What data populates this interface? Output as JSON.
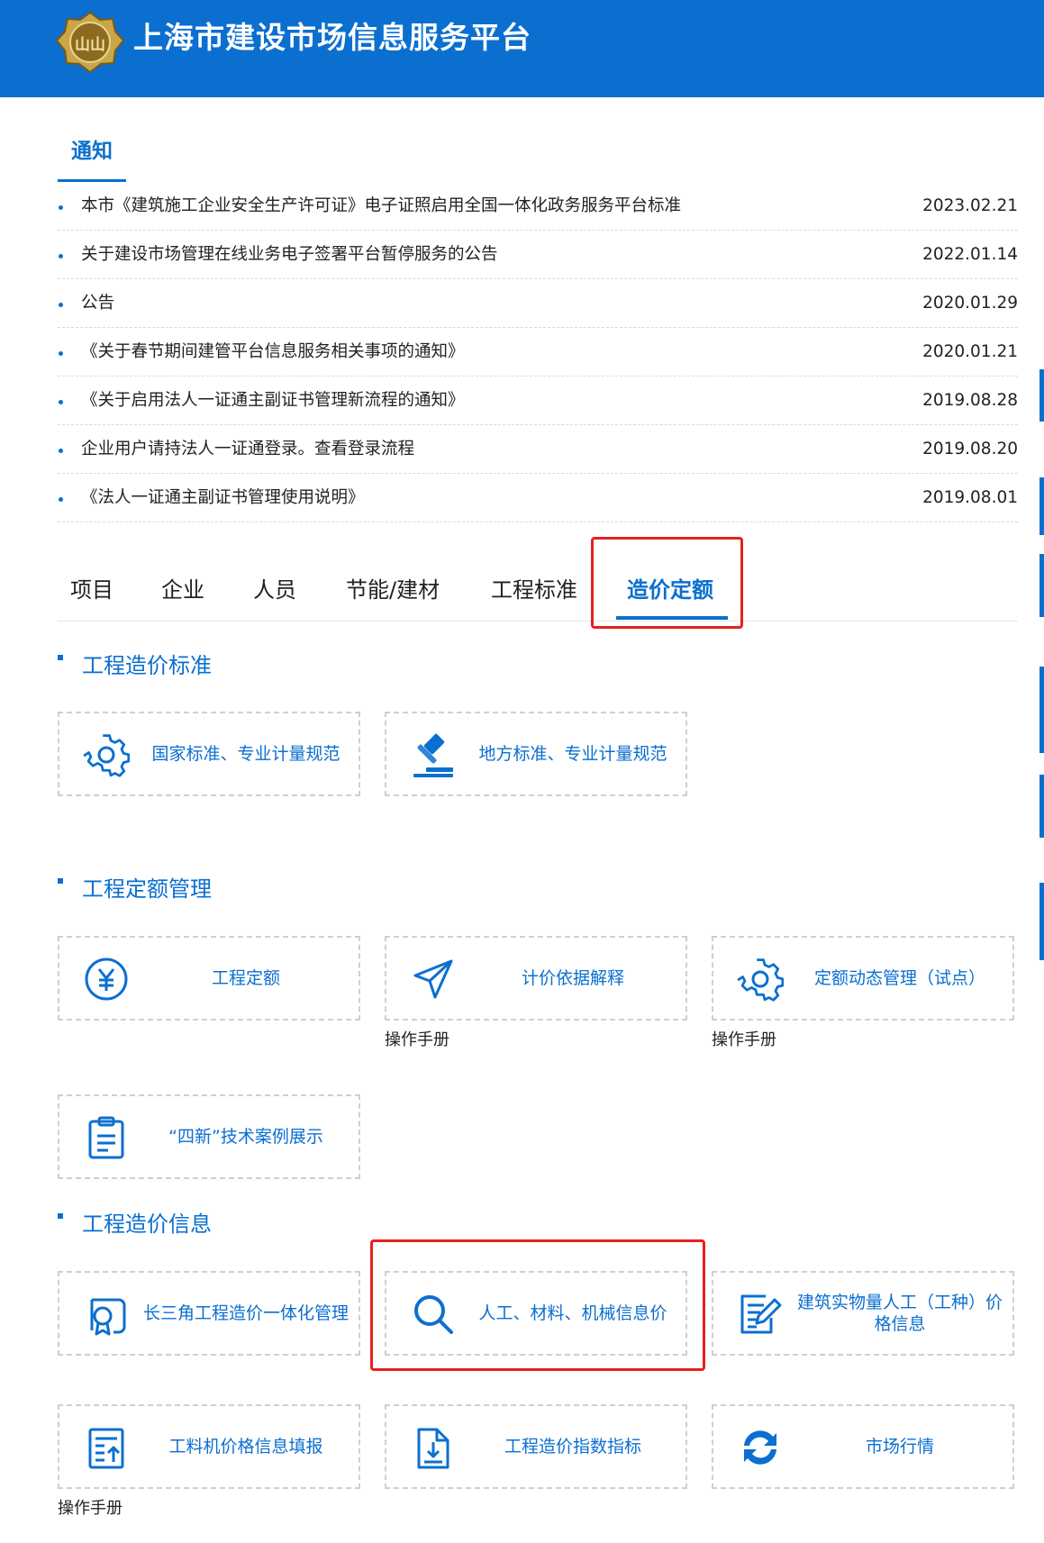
{
  "header": {
    "site_title": "上海市建设市场信息服务平台",
    "logo_text": "山山",
    "brand_color": "#0b6fd0"
  },
  "notices": {
    "tab_label": "通知",
    "items": [
      {
        "title": "本市《建筑施工企业安全生产许可证》电子证照启用全国一体化政务服务平台标准",
        "date": "2023.02.21"
      },
      {
        "title": "关于建设市场管理在线业务电子签署平台暂停服务的公告",
        "date": "2022.01.14"
      },
      {
        "title": "公告",
        "date": "2020.01.29"
      },
      {
        "title": "《关于春节期间建管平台信息服务相关事项的通知》",
        "date": "2020.01.21"
      },
      {
        "title": "《关于启用法人一证通主副证书管理新流程的通知》",
        "date": "2019.08.28"
      },
      {
        "title": "企业用户请持法人一证通登录。查看登录流程",
        "date": "2019.08.20"
      },
      {
        "title": "《法人一证通主副证书管理使用说明》",
        "date": "2019.08.01"
      }
    ]
  },
  "category_tabs": [
    {
      "label": "项目"
    },
    {
      "label": "企业"
    },
    {
      "label": "人员"
    },
    {
      "label": "节能/建材"
    },
    {
      "label": "工程标准"
    },
    {
      "label": "造价定额",
      "active": true
    }
  ],
  "sections": {
    "standards": {
      "title": "工程造价标准",
      "cards": [
        {
          "label": "国家标准、专业计量规范",
          "icon": "gear-icon"
        },
        {
          "label": "地方标准、专业计量规范",
          "icon": "gavel-icon"
        }
      ]
    },
    "quota": {
      "title": "工程定额管理",
      "cards": [
        {
          "label": "工程定额",
          "icon": "yen-circle-icon"
        },
        {
          "label": "计价依据解释",
          "icon": "paper-plane-icon",
          "manual": "操作手册"
        },
        {
          "label": "定额动态管理（试点）",
          "icon": "gear-icon",
          "manual": "操作手册"
        },
        {
          "label": "“四新”技术案例展示",
          "icon": "clipboard-icon"
        }
      ]
    },
    "price_info": {
      "title": "工程造价信息",
      "cards": [
        {
          "label": "长三角工程造价一体化管理",
          "icon": "certificate-icon"
        },
        {
          "label": "人工、材料、机械信息价",
          "icon": "search-icon"
        },
        {
          "label": "建筑实物量人工（工种）价格信息",
          "icon": "edit-document-icon"
        },
        {
          "label": "工料机价格信息填报",
          "icon": "upload-document-icon",
          "manual": "操作手册"
        },
        {
          "label": "工程造价指数指标",
          "icon": "download-document-icon"
        },
        {
          "label": "市场行情",
          "icon": "refresh-icon"
        }
      ]
    }
  }
}
